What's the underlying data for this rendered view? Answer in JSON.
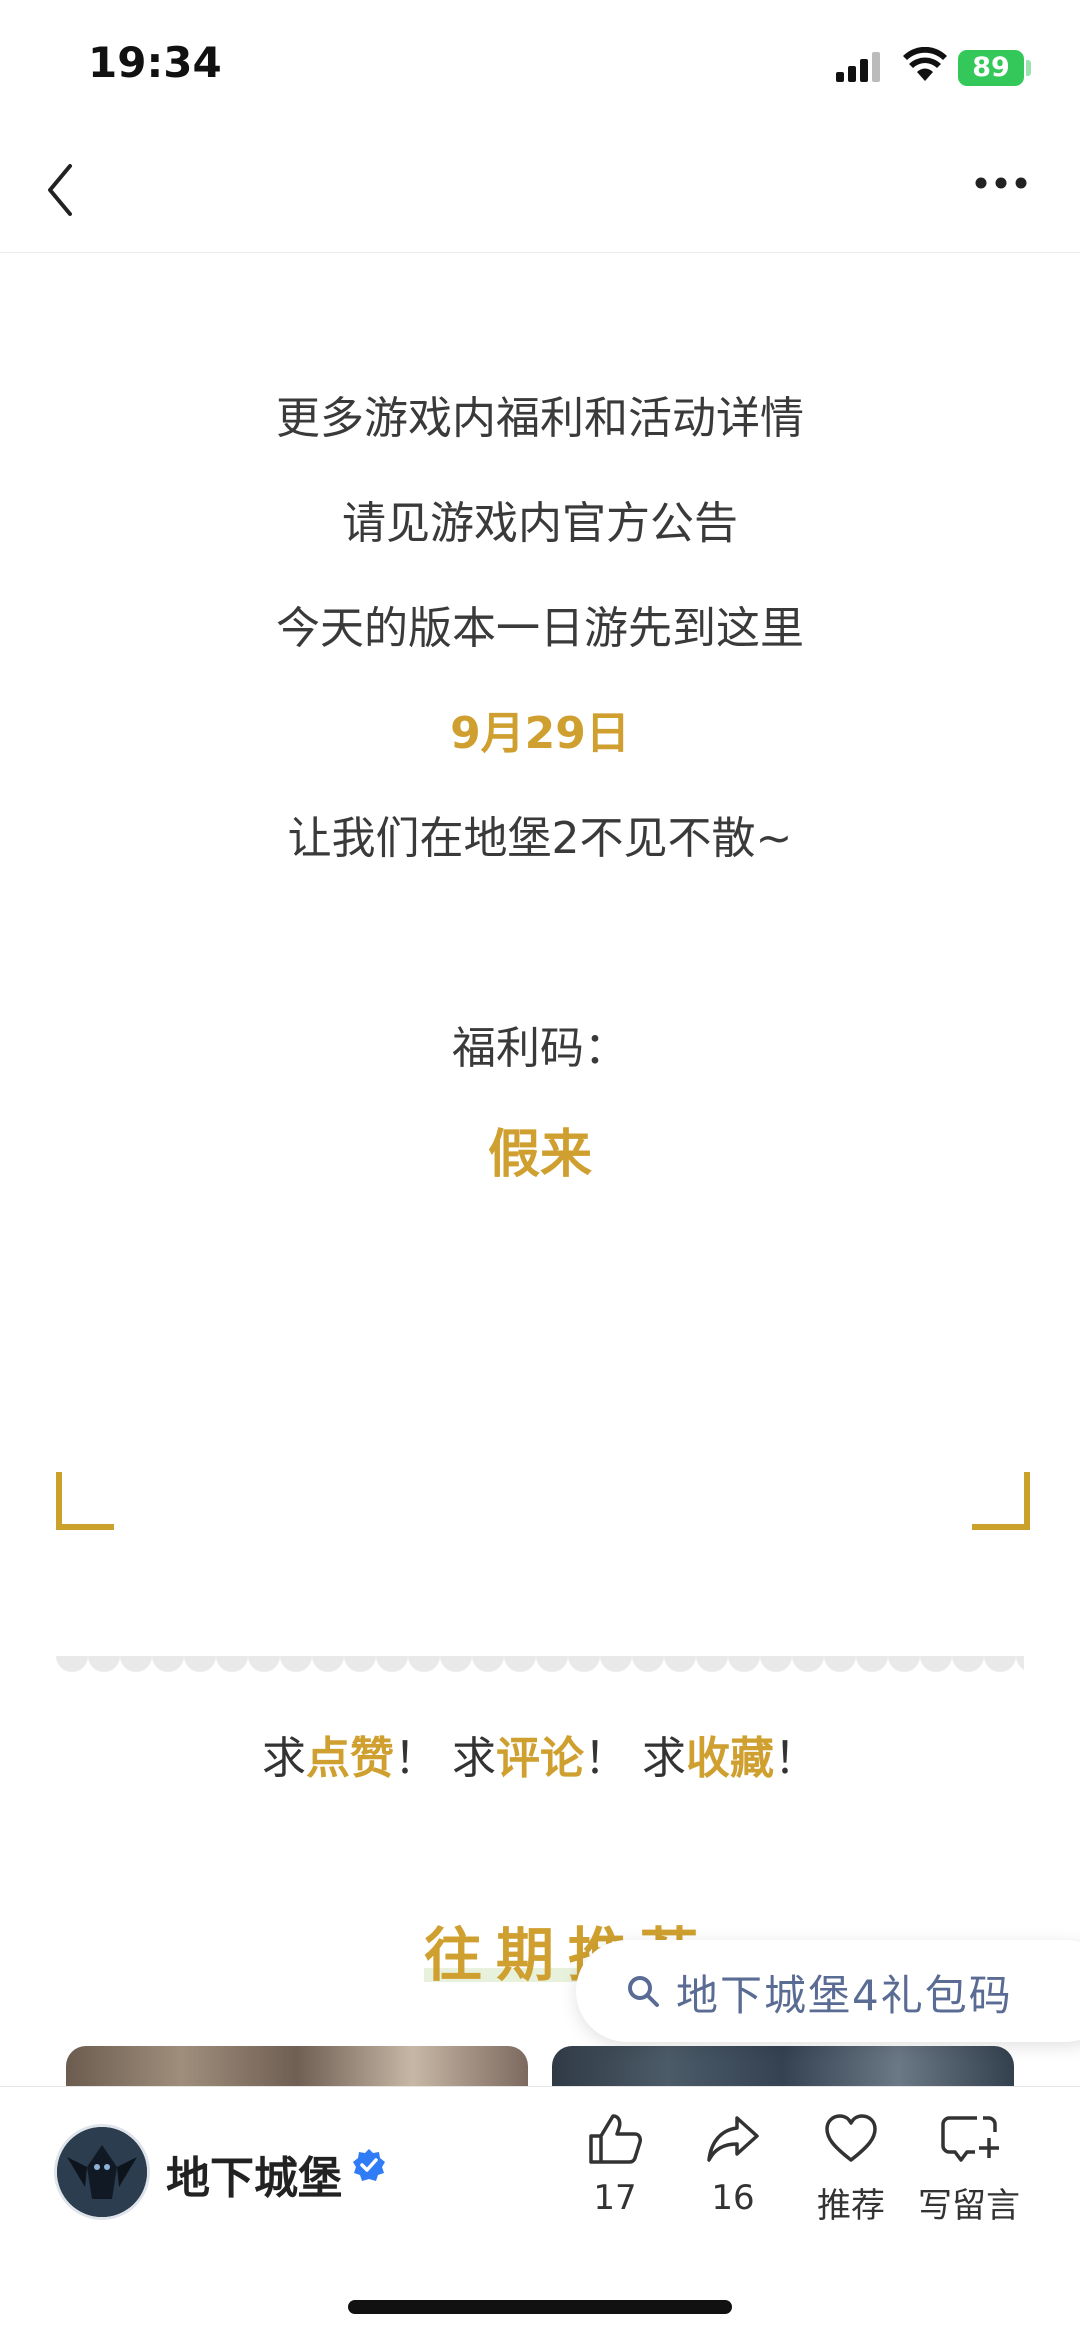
{
  "status_bar": {
    "time": "19:34",
    "battery": "89"
  },
  "article": {
    "lines": [
      "更多游戏内福利和活动详情",
      "请见游戏内官方公告",
      "今天的版本一日游先到这里",
      "9月29日",
      "让我们在地堡2不见不散~"
    ],
    "code_label": "福利码：",
    "code_value": "假来",
    "cta": {
      "p1": "求",
      "h1": "点赞",
      "p2": "！ 求",
      "h2": "评论",
      "p3": "！ 求",
      "h3": "收藏",
      "p4": "！"
    },
    "recommend_title": "往期推荐"
  },
  "search_suggestion": "地下城堡4礼包码",
  "bottom_bar": {
    "account_name": "地下城堡",
    "like_count": "17",
    "share_count": "16",
    "recommend_label": "推荐",
    "comment_label": "写留言"
  },
  "colors": {
    "accent_gold": "#cfa02f",
    "battery_green": "#34c759",
    "search_text": "#5a6c93"
  }
}
